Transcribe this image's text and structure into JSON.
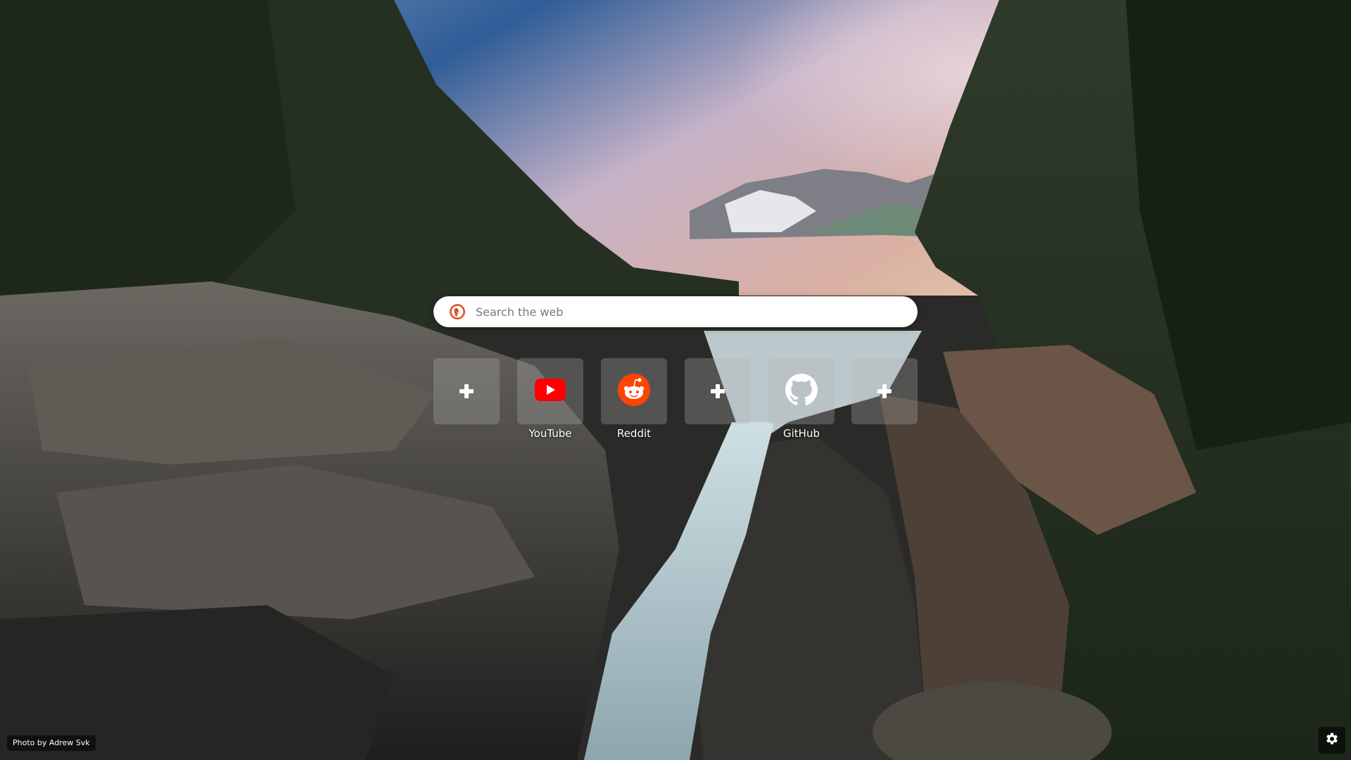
{
  "search": {
    "placeholder": "Search the web",
    "engine_icon": "duckduckgo-icon"
  },
  "tiles": [
    {
      "type": "add",
      "icon": "plus-icon",
      "label": ""
    },
    {
      "type": "site",
      "icon": "youtube-icon",
      "label": "YouTube",
      "color": "#ff0000"
    },
    {
      "type": "site",
      "icon": "reddit-icon",
      "label": "Reddit",
      "color": "#ff4500"
    },
    {
      "type": "add",
      "icon": "plus-icon",
      "label": ""
    },
    {
      "type": "site",
      "icon": "github-icon",
      "label": "GitHub",
      "color": "#ffffff"
    },
    {
      "type": "add",
      "icon": "plus-icon",
      "label": ""
    }
  ],
  "footer": {
    "photo_credit": "Photo by Adrew Svk",
    "settings_icon": "gear-icon"
  }
}
